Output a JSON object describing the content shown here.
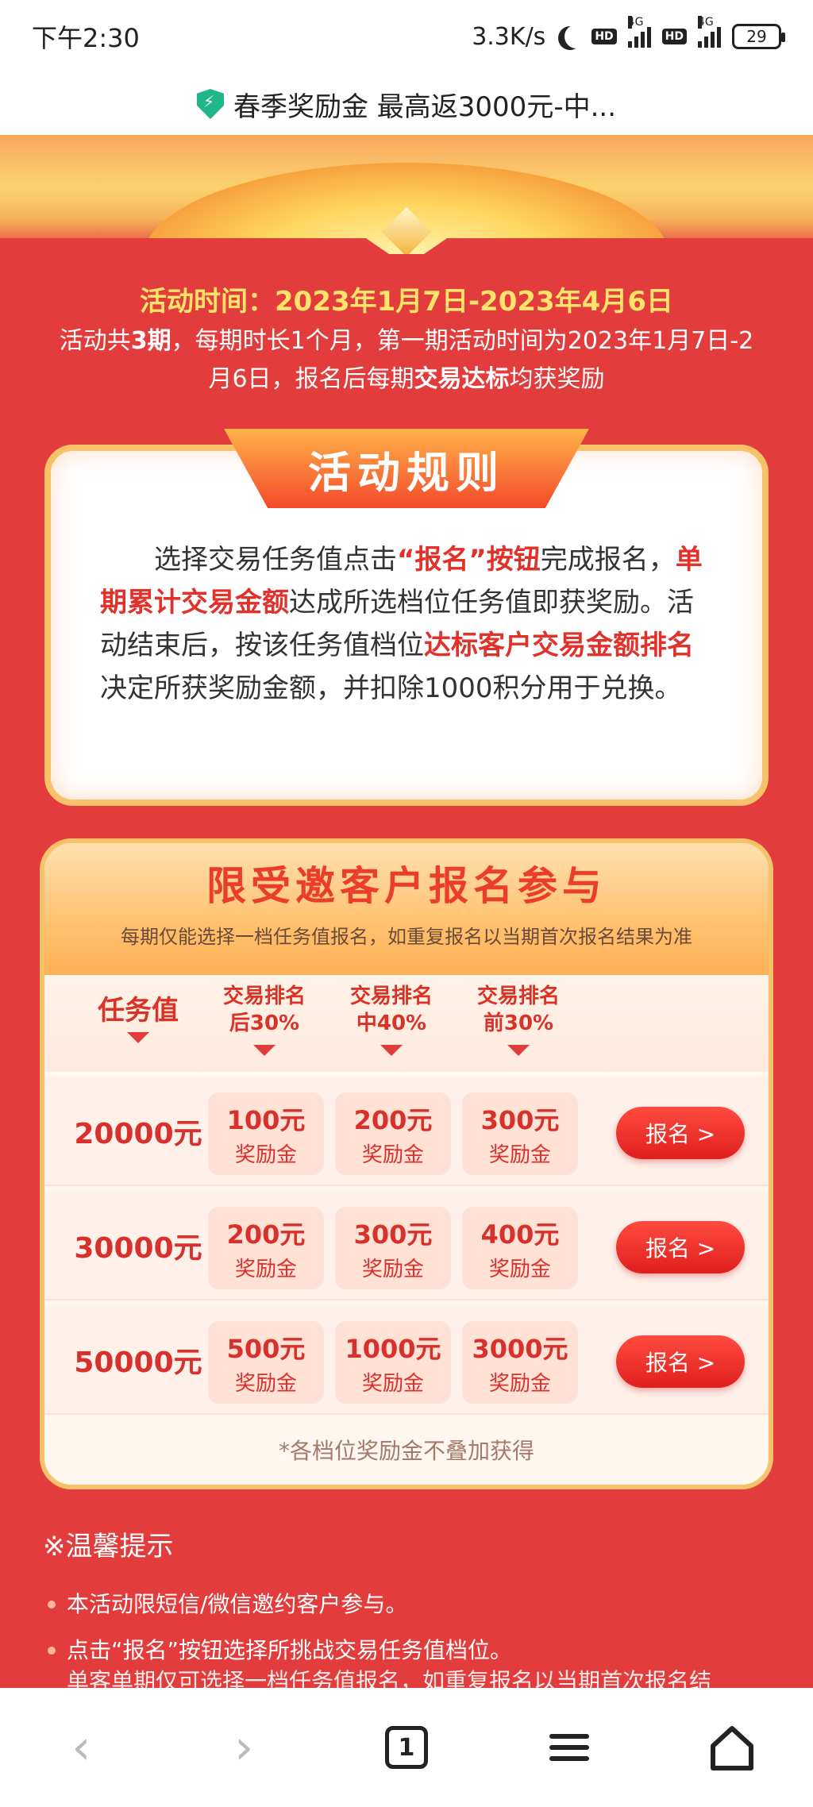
{
  "status": {
    "time": "下午2:30",
    "speed": "3.3K/s",
    "hd1": "HD",
    "net1": "4G",
    "hd2": "HD",
    "net2": "4G",
    "battery": "29"
  },
  "titlebar": {
    "title": "春季奖励金 最高返3000元-中..."
  },
  "activity": {
    "time": "活动时间：2023年1月7日-2023年4月6日",
    "desc_part1": "活动共",
    "desc_periods": "3期",
    "desc_part2": "，每期时长1个月，第一期活动时间为2023年1月7日-2月6日，报名后每期",
    "desc_highlight": "交易达标",
    "desc_part3": "均获奖励"
  },
  "rules": {
    "title": "活动规则",
    "t1": "选择交易任务值点击",
    "t2": "“报名”按钮",
    "t3": "完成报名，",
    "t4": "单期累计交易金额",
    "t5": "达成所选档位任务值即获奖励。活动结束后，按该任务值档位",
    "t6": "达标客户交易金额排名",
    "t7": "决定所获奖励金额，并扣除1000积分用于兑换。"
  },
  "invite": {
    "title": "限受邀客户报名参与",
    "subtitle": "每期仅能选择一档任务值报名，如重复报名以当期首次报名结果为准",
    "col_task": "任务值",
    "col1_top": "交易排名",
    "col1_bottom": "后30%",
    "col2_top": "交易排名",
    "col2_bottom": "中40%",
    "col3_top": "交易排名",
    "col3_bottom": "前30%",
    "reward_unit": "奖励金",
    "button": "报名 >",
    "rows": [
      {
        "amount": "20000元",
        "r1": "100元",
        "r2": "200元",
        "r3": "300元"
      },
      {
        "amount": "30000元",
        "r1": "200元",
        "r2": "300元",
        "r3": "400元"
      },
      {
        "amount": "50000元",
        "r1": "500元",
        "r2": "1000元",
        "r3": "3000元"
      }
    ],
    "note": "*各档位奖励金不叠加获得"
  },
  "tips": {
    "title": "※温馨提示",
    "items": [
      "本活动限短信/微信邀约客户参与。",
      "点击“报名”按钮选择所挑战交易任务值档位。"
    ],
    "cut": "单客单期仅可选择一档任务值报名，如重复报名以当期首次报名结"
  },
  "nav": {
    "back": "‹",
    "forward": "›",
    "tabs": "1"
  }
}
